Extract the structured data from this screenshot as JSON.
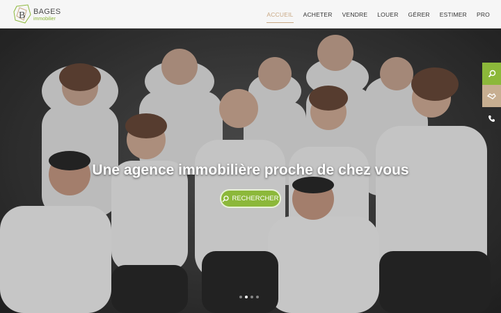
{
  "header": {
    "logo_name": "BAGES",
    "logo_sub": "immobilier",
    "nav": [
      {
        "label": "ACCUEIL",
        "active": true
      },
      {
        "label": "ACHETER",
        "active": false
      },
      {
        "label": "VENDRE",
        "active": false
      },
      {
        "label": "LOUER",
        "active": false
      },
      {
        "label": "GÉRER",
        "active": false
      },
      {
        "label": "ESTIMER",
        "active": false
      },
      {
        "label": "PRO",
        "active": false
      }
    ]
  },
  "hero": {
    "title": "Une agence immobilière proche de chez vous",
    "button_label": "RECHERCHER",
    "slides_count": 4,
    "active_slide": 2
  },
  "side_buttons": [
    {
      "icon": "search-icon",
      "color": "#8cb83a"
    },
    {
      "icon": "handshake-icon",
      "color": "#c7ae91"
    },
    {
      "icon": "phone-icon",
      "color": "#2b2b2b"
    }
  ],
  "colors": {
    "accent": "#8cb83a",
    "nav_active": "#c9a884"
  }
}
